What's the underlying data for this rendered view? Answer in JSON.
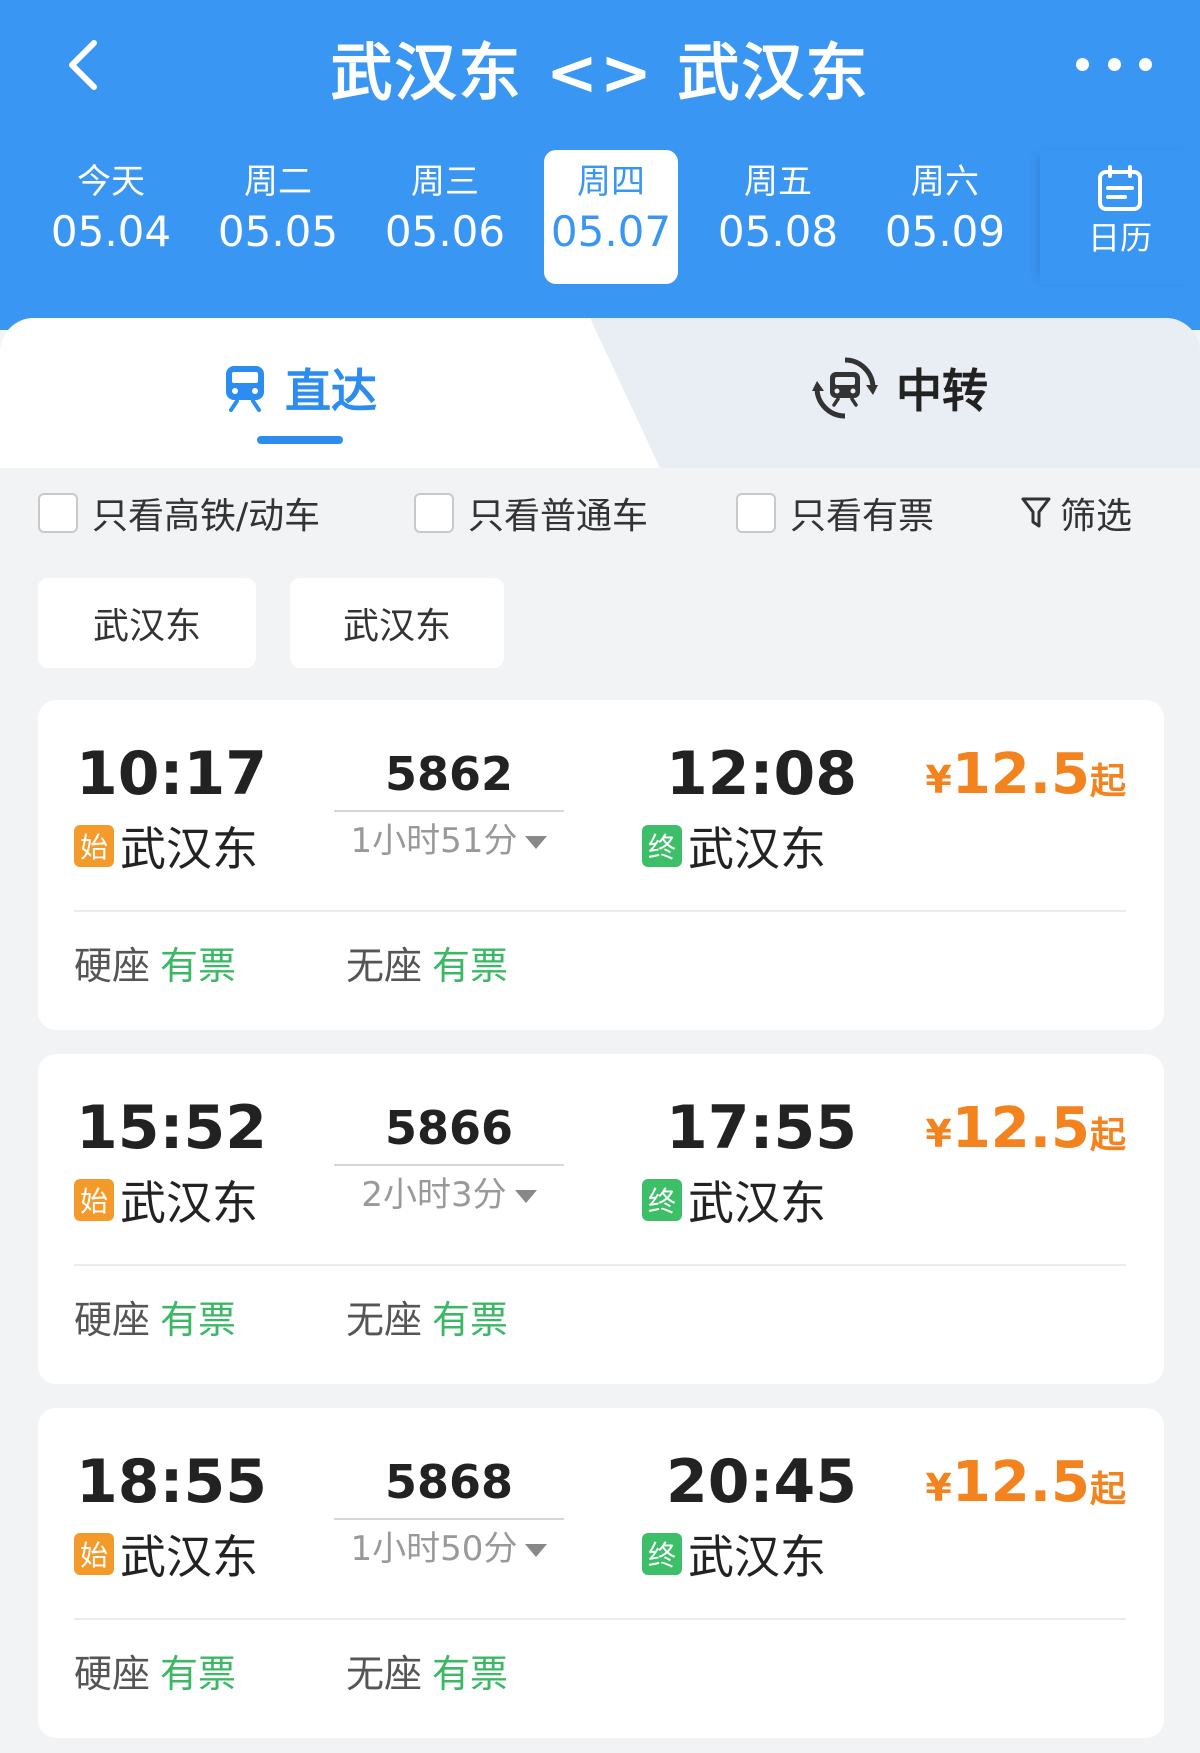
{
  "header": {
    "title": "武汉东 <> 武汉东",
    "accent_color": "#3a96f3"
  },
  "dates": [
    {
      "dow": "今天",
      "date": "05.04"
    },
    {
      "dow": "周二",
      "date": "05.05"
    },
    {
      "dow": "周三",
      "date": "05.06"
    },
    {
      "dow": "周四",
      "date": "05.07",
      "selected": true
    },
    {
      "dow": "周五",
      "date": "05.08"
    },
    {
      "dow": "周六",
      "date": "05.09"
    }
  ],
  "calendar": {
    "label": "日历",
    "icon": "calendar-icon"
  },
  "tabs": {
    "direct": {
      "label": "直达",
      "icon": "train-icon",
      "active": true
    },
    "transfer": {
      "label": "中转",
      "icon": "transfer-train-icon"
    }
  },
  "filters": {
    "items": [
      {
        "label": "只看高铁/动车",
        "checked": false
      },
      {
        "label": "只看普通车",
        "checked": false
      },
      {
        "label": "只看有票",
        "checked": false
      }
    ],
    "filter_button": {
      "label": "筛选",
      "icon": "funnel-icon"
    }
  },
  "station_chips": [
    "武汉东",
    "武汉东"
  ],
  "trains": [
    {
      "dep_time": "10:17",
      "dep_station": "武汉东",
      "dep_badge": "始",
      "train_no": "5862",
      "duration": "1小时51分",
      "arr_time": "12:08",
      "arr_station": "武汉东",
      "arr_badge": "终",
      "price_currency": "¥",
      "price_amount": "12.5",
      "price_suffix": "起",
      "seats": [
        {
          "type": "硬座",
          "avail": "有票"
        },
        {
          "type": "无座",
          "avail": "有票"
        }
      ]
    },
    {
      "dep_time": "15:52",
      "dep_station": "武汉东",
      "dep_badge": "始",
      "train_no": "5866",
      "duration": "2小时3分",
      "arr_time": "17:55",
      "arr_station": "武汉东",
      "arr_badge": "终",
      "price_currency": "¥",
      "price_amount": "12.5",
      "price_suffix": "起",
      "seats": [
        {
          "type": "硬座",
          "avail": "有票"
        },
        {
          "type": "无座",
          "avail": "有票"
        }
      ]
    },
    {
      "dep_time": "18:55",
      "dep_station": "武汉东",
      "dep_badge": "始",
      "train_no": "5868",
      "duration": "1小时50分",
      "arr_time": "20:45",
      "arr_station": "武汉东",
      "arr_badge": "终",
      "price_currency": "¥",
      "price_amount": "12.5",
      "price_suffix": "起",
      "seats": [
        {
          "type": "硬座",
          "avail": "有票"
        },
        {
          "type": "无座",
          "avail": "有票"
        }
      ]
    }
  ]
}
